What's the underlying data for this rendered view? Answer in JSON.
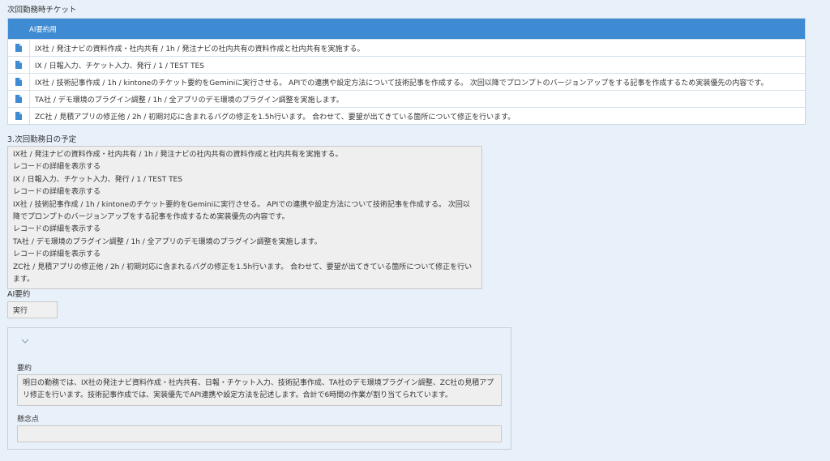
{
  "labels": {
    "next_tickets": "次回勤務時チケット",
    "schedule": "3.次回勤務日の予定",
    "ai_summary": "AI要約",
    "summary": "要約",
    "concerns": "懸念点"
  },
  "ticket_table": {
    "header": "AI要約用",
    "rows": [
      "IX社 / 発注ナビの資料作成・社内共有 / 1h / 発注ナビの社内共有の資料作成と社内共有を実施する。",
      "IX / 日報入力、チケット入力、発行 / 1 /  TEST TES",
      "IX社 / 技術記事作成 / 1h / kintoneのチケット要約をGeminiに実行させる。 APIでの連携や設定方法について技術記事を作成する。 次回以降でプロンプトのバージョンアップをする記事を作成するため実装優先の内容です。",
      "TA社 / デモ環境のプラグイン調整 / 1h / 全アプリのデモ環境のプラグイン調整を実施します。",
      "ZC社 / 見積アプリの修正他 / 2h / 初期対応に含まれるバグの修正を1.5h行います。 合わせて、要望が出てきている箇所について修正を行います。"
    ]
  },
  "schedule_lines": [
    "IX社 / 発注ナビの資料作成・社内共有 / 1h / 発注ナビの社内共有の資料作成と社内共有を実施する。",
    "レコードの詳細を表示する",
    "IX / 日報入力、チケット入力、発行 / 1 /  TEST TES",
    "レコードの詳細を表示する",
    "IX社 / 技術記事作成 / 1h / kintoneのチケット要約をGeminiに実行させる。 APIでの連携や設定方法について技術記事を作成する。 次回以降でプロンプトのバージョンアップをする記事を作成するため実装優先の内容です。",
    "レコードの詳細を表示する",
    "TA社 / デモ環境のプラグイン調整 / 1h / 全アプリのデモ環境のプラグイン調整を実施します。",
    "レコードの詳細を表示する",
    "ZC社 / 見積アプリの修正他 / 2h / 初期対応に含まれるバグの修正を1.5h行います。 合わせて、要望が出てきている箇所について修正を行います。"
  ],
  "run_button": "実行",
  "summary_text": "明日の勤務では、IX社の発注ナビ資料作成・社内共有、日報・チケット入力、技術記事作成、TA社のデモ環境プラグイン調整、ZC社の見積アプリ修正を行います。技術記事作成では、実装優先でAPI連携や設定方法を記述します。合計で6時間の作業が割り当てられています。",
  "concerns_text": "",
  "icons": {
    "row_icon": "document-icon",
    "panel_toggle": "chevron-down-icon"
  },
  "colors": {
    "header_bg": "#3f8bd3",
    "page_bg": "#e8f1fa",
    "doc_icon": "#3f8bd3"
  }
}
